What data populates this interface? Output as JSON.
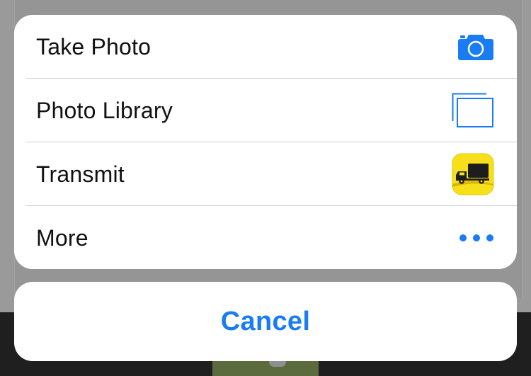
{
  "action_sheet": {
    "items": [
      {
        "label": "Take Photo",
        "icon": "camera-icon"
      },
      {
        "label": "Photo Library",
        "icon": "photo-library-icon"
      },
      {
        "label": "Transmit",
        "icon": "transmit-app-icon"
      },
      {
        "label": "More",
        "icon": "more-icon"
      }
    ],
    "cancel_label": "Cancel"
  },
  "colors": {
    "accent": "#1a7cf3",
    "transmit_bg": "#f7e01a"
  }
}
